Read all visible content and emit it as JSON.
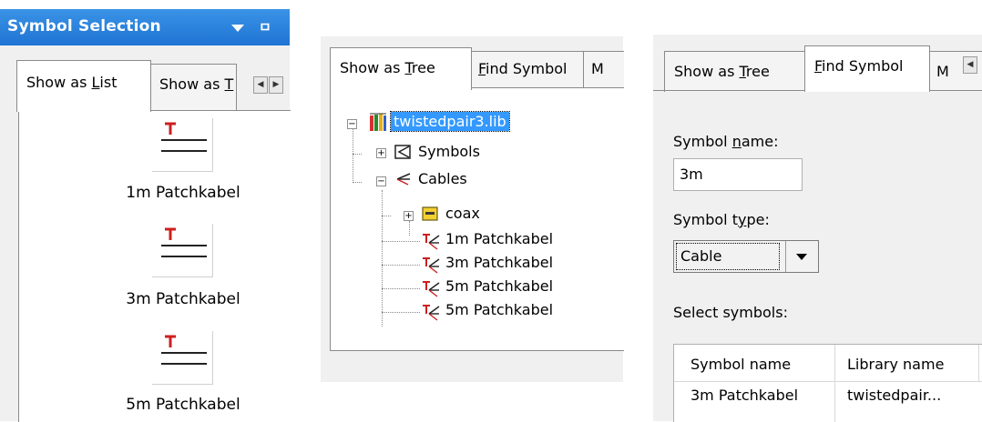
{
  "panel1": {
    "title": "Symbol Selection",
    "tabs": [
      {
        "pre": "Show as ",
        "acc": "L",
        "post": "ist"
      },
      {
        "pre": "Show as ",
        "acc": "T",
        "post": ""
      }
    ],
    "items": [
      "1m Patchkabel",
      "3m Patchkabel",
      "5m Patchkabel"
    ]
  },
  "panel2": {
    "tabs": [
      {
        "pre": "Show as ",
        "acc": "T",
        "post": "ree"
      },
      {
        "pre": "",
        "acc": "F",
        "post": "ind Symbol"
      },
      {
        "pre": "M",
        "acc": "",
        "post": ""
      }
    ],
    "tree": {
      "root": "twistedpair3.lib",
      "symbols": "Symbols",
      "cables": "Cables",
      "coax": "coax",
      "cable_items": [
        "1m Patchkabel",
        "3m Patchkabel",
        "5m Patchkabel",
        "5m Patchkabel"
      ]
    }
  },
  "panel3": {
    "tabs": [
      {
        "pre": "Show as ",
        "acc": "T",
        "post": "ree"
      },
      {
        "pre": "",
        "acc": "F",
        "post": "ind Symbol"
      },
      {
        "pre": "M",
        "acc": "",
        "post": ""
      }
    ],
    "symbol_name_label": {
      "pre": "Symbol ",
      "acc": "n",
      "post": "ame:"
    },
    "symbol_name_value": "3m",
    "symbol_type_label": {
      "pre": "Symbol t",
      "acc": "y",
      "post": "pe:"
    },
    "symbol_type_value": "Cable",
    "select_symbols_label": "Select symbols:",
    "columns": [
      "Symbol name",
      "Library name"
    ],
    "rows": [
      [
        "3m Patchkabel",
        "twistedpair..."
      ]
    ]
  },
  "colors": {
    "titlebar": "#2a84de",
    "tree_selection": "#3399ff",
    "cable_icon_red": "#cc2020"
  },
  "icons": {
    "pin": "pin-icon",
    "dropdown": "triangle-down-icon",
    "library": "library-icon",
    "folder": "folder-icon",
    "cable": "cable-icon"
  }
}
